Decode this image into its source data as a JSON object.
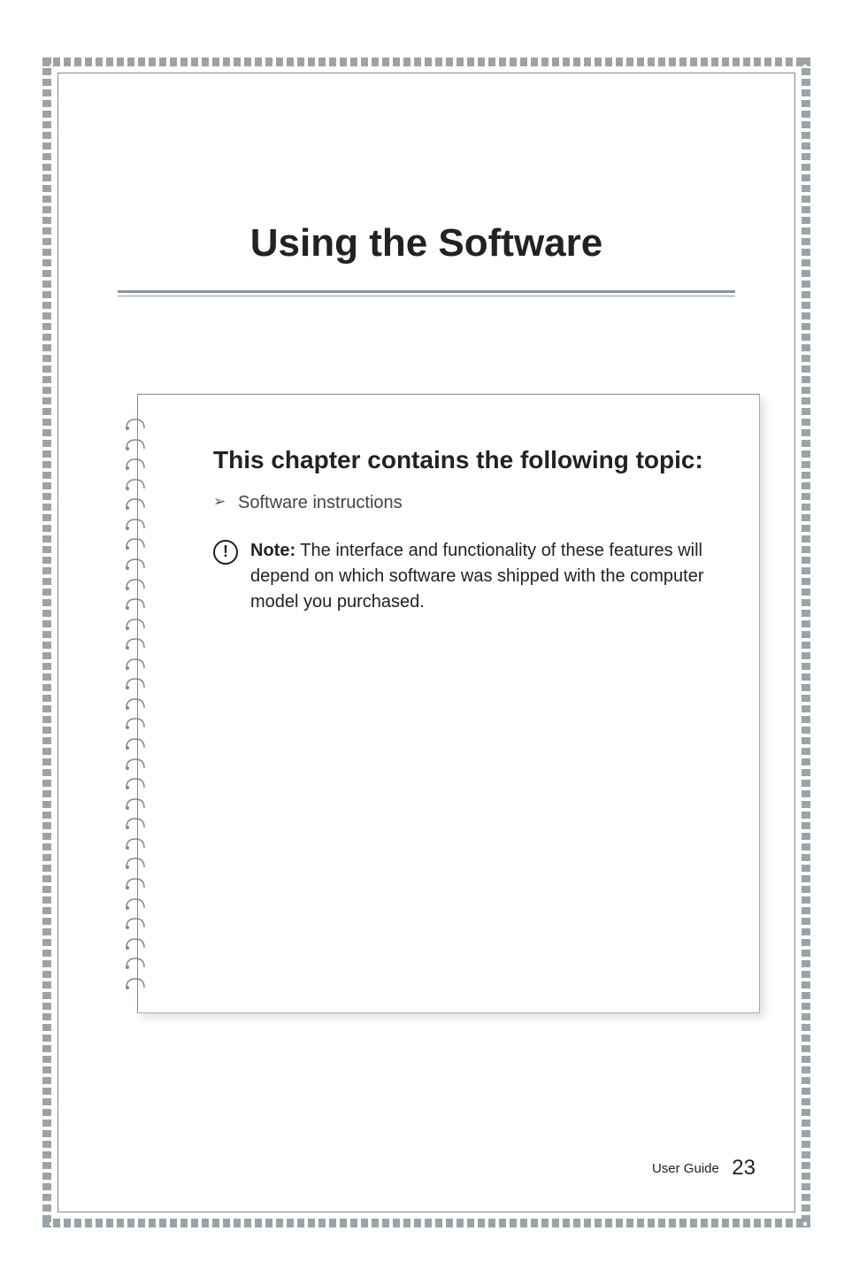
{
  "chapter": {
    "title": "Using the Software"
  },
  "topicBox": {
    "heading": "This chapter contains the following topic:",
    "items": [
      "Software instructions"
    ],
    "note": {
      "label": "Note:",
      "text": " The interface and functionality of these features will depend on which software was shipped with the computer model you purchased."
    }
  },
  "footer": {
    "label": "User Guide",
    "pageNumber": "23"
  }
}
